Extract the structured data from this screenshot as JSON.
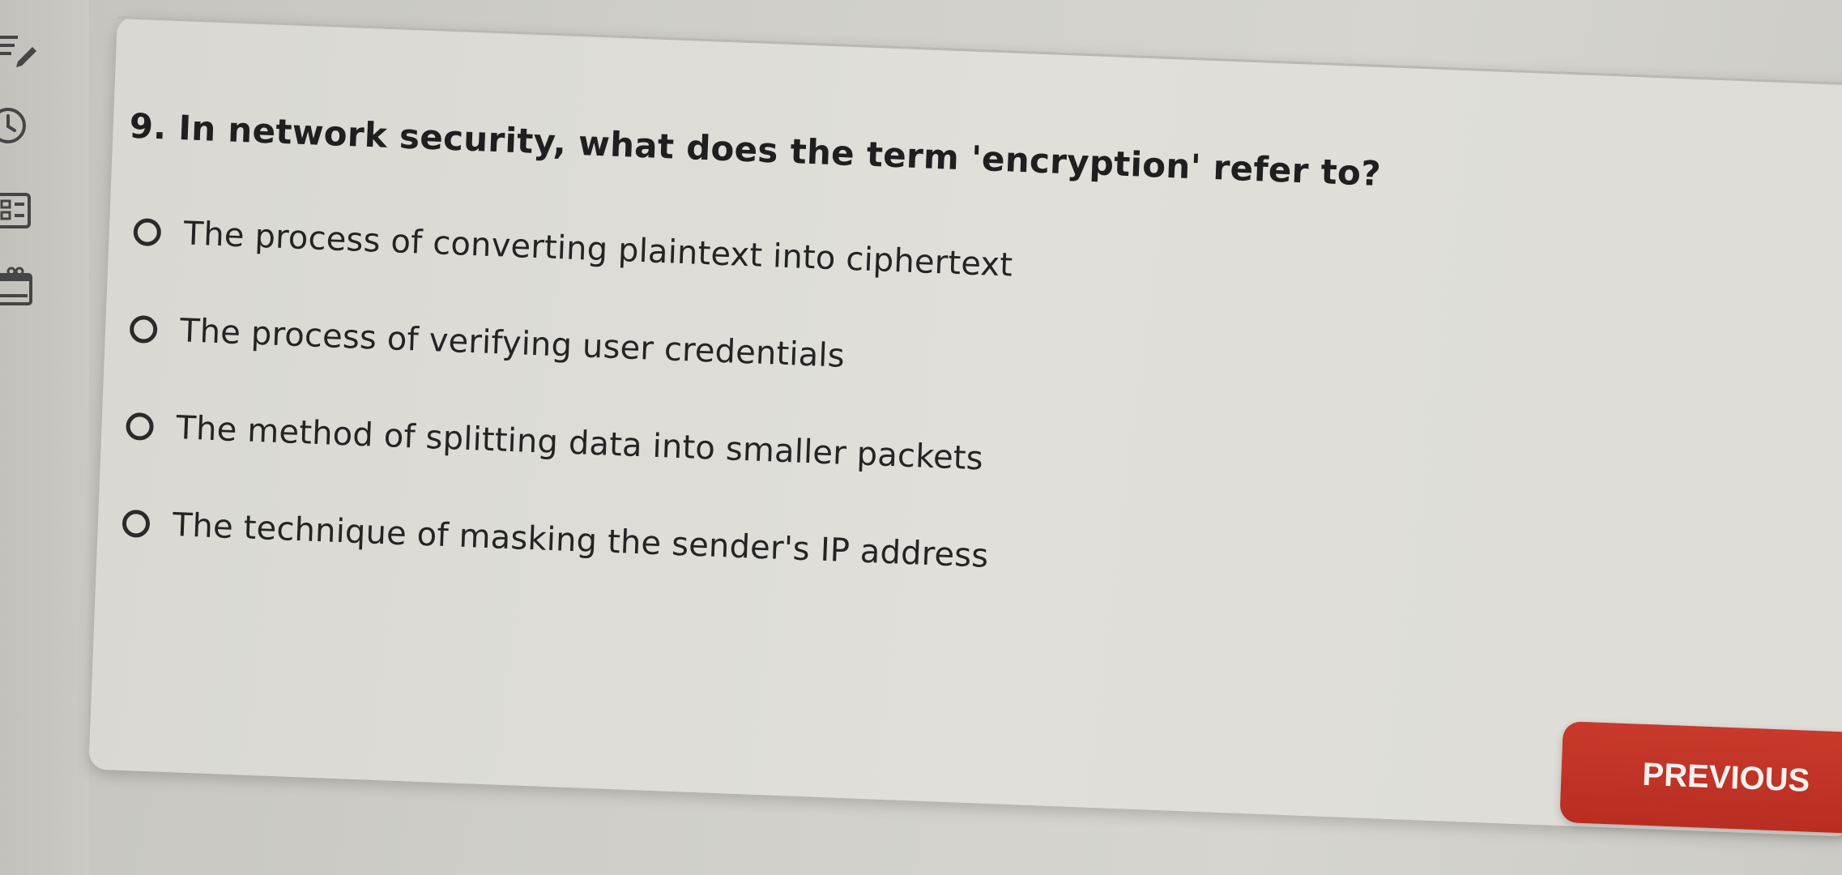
{
  "question": {
    "text": "9. In network security, what does the term 'encryption' refer to?"
  },
  "options": [
    {
      "label": "The process of converting plaintext into ciphertext",
      "selected": false
    },
    {
      "label": "The process of verifying user credentials",
      "selected": false
    },
    {
      "label": "The method of splitting data into smaller packets",
      "selected": false
    },
    {
      "label": "The technique of masking the sender's IP address",
      "selected": false
    }
  ],
  "navigation": {
    "previous_label": "PREVIOUS"
  },
  "sidebar": {
    "icons": [
      "edit-list-icon",
      "clock-icon",
      "grid-layout-icon",
      "calendar-icon"
    ]
  },
  "colors": {
    "accent": "#c0362a",
    "card_background": "#dedcd6",
    "text": "#222222"
  }
}
